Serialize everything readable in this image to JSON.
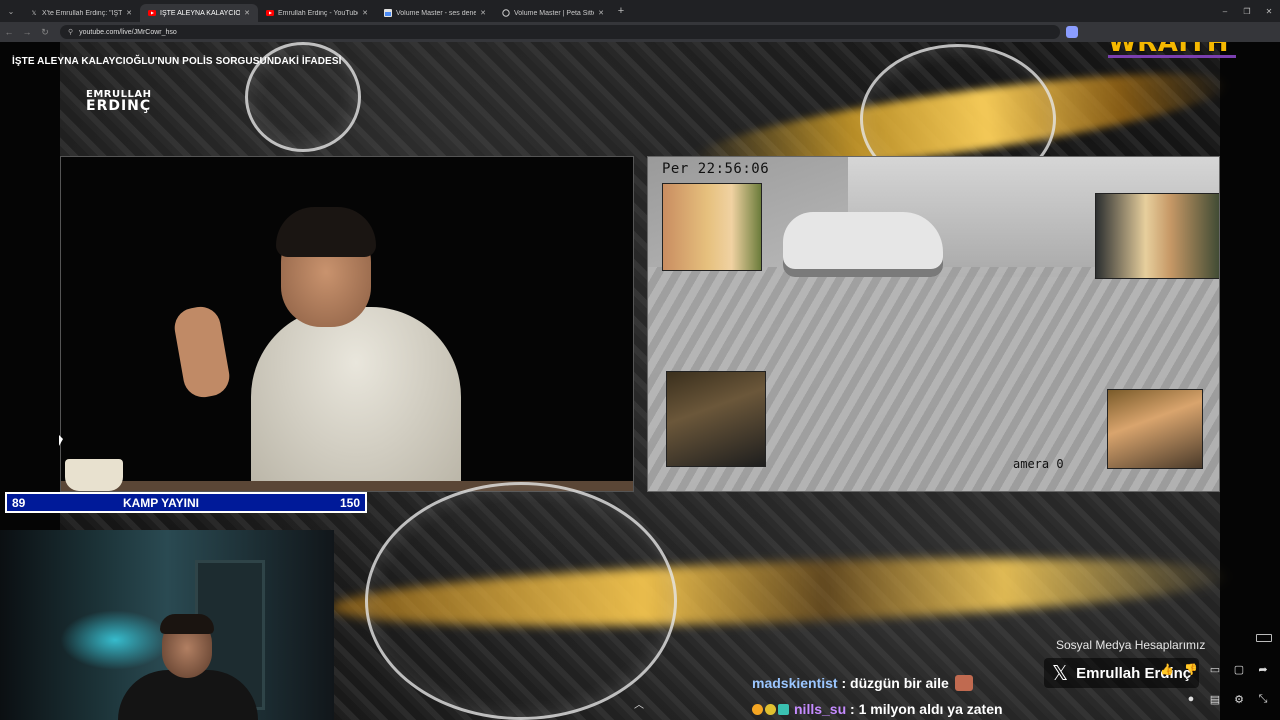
{
  "browser": {
    "tabs": [
      {
        "title": "X'te Emrullah Erdinç: \"İŞTE ALEY...",
        "icon": "x-logo-icon",
        "active": false
      },
      {
        "title": "İŞTE ALEYNA KALAYCIOĞLU",
        "icon": "youtube-icon",
        "active": true
      },
      {
        "title": "Emrullah Erdinç - YouTube",
        "icon": "youtube-icon",
        "active": false
      },
      {
        "title": "Volume Master - ses denetleyic",
        "icon": "chrome-webstore-icon",
        "active": false
      },
      {
        "title": "Volume Master | Peta Sittek",
        "icon": "globe-icon",
        "active": false
      }
    ],
    "url": "youtube.com/live/JMrCowr_hso",
    "colors": {
      "tabbar": "#202124",
      "active_tab": "#35363a"
    }
  },
  "stream": {
    "topic_title": "İŞTE ALEYNA KALAYCIOĞLU'NUN POLİS SORGUSUNDAKİ İFADESİ",
    "logo_line1": "EMRULLAH",
    "logo_line2": "ERDINÇ",
    "sponsor": "WRAITH",
    "cctv_timestamp": "Per 22:56:06",
    "cctv_camera": "amera 0",
    "kamp": {
      "left": "89",
      "center": "KAMP YAYINI",
      "right": "150",
      "color": "#001a99"
    },
    "social_label": "Sosyal Medya Hesaplarımız",
    "x_handle": "Emrullah Erdinç"
  },
  "chat": [
    {
      "user": "madskientist",
      "sep": " : ",
      "message": "düzgün bir aile",
      "user_color": "#9bc6ff"
    },
    {
      "user": "nills_su",
      "sep": " : ",
      "message": "1 milyon aldı ya zaten",
      "user_color": "#c58bff"
    }
  ],
  "colors": {
    "sponsor": "#f5b800",
    "gold_accent": "#ffd25a"
  }
}
